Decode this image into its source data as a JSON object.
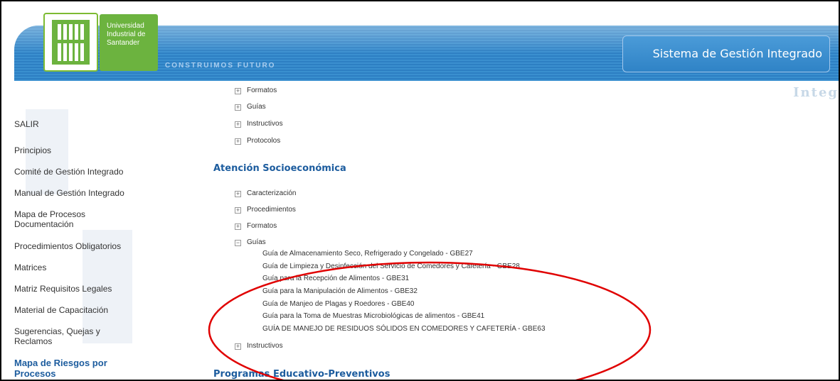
{
  "header": {
    "university_lines": [
      "Universidad",
      "Industrial de",
      "Santander"
    ],
    "tagline": "CONSTRUIMOS FUTURO",
    "system_title": "Sistema de Gestión Integrado",
    "shadow_text": "Integ"
  },
  "sidebar": {
    "items": [
      "SALIR",
      "Principios",
      "Comité de Gestión Integrado",
      "Manual de Gestión Integrado",
      "Mapa de Procesos\nDocumentación",
      "Procedimientos Obligatorios",
      "Matrices",
      "Matriz Requisitos Legales",
      "Material de Capacitación",
      "Sugerencias, Quejas y\nReclamos",
      "Mapa de Riesgos por\nProcesos"
    ]
  },
  "main": {
    "top_tree": [
      "Formatos",
      "Guías",
      "Instructivos",
      "Protocolos"
    ],
    "section1_title": "Atención Socioeconómica",
    "section1_tree": [
      "Caracterización",
      "Procedimientos",
      "Formatos",
      "Guías"
    ],
    "guides": [
      "Guía de Almacenamiento Seco, Refrigerado y Congelado - GBE27",
      "Guía de Limpieza y Desinfección del Servicio de Comedores y Cafetería - GBE28",
      "Guía para la Recepción de Alimentos - GBE31",
      "Guía para la Manipulación de Alimentos - GBE32",
      "Guía de Manjeo de Plagas y Roedores - GBE40",
      "Guía para la Toma de Muestras Microbiológicas de alimentos - GBE41",
      "GUÍA DE MANEJO DE RESIDUOS SÓLIDOS EN COMEDORES Y CAFETERÍA - GBE63"
    ],
    "after_guides": "Instructivos",
    "section2_title": "Programas Educativo-Preventivos"
  },
  "colors": {
    "header_blue": "#2d7fc3",
    "brand_green": "#6cb33f",
    "link_blue": "#1c5c9e",
    "annotation_red": "#e00000"
  }
}
